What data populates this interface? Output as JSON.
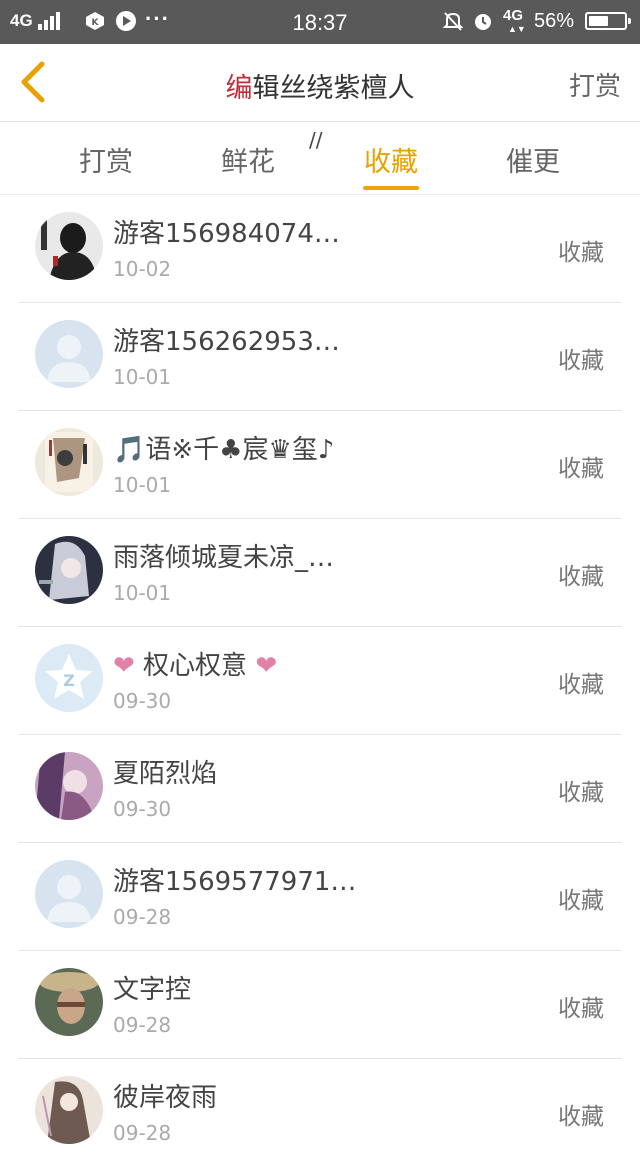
{
  "status_bar": {
    "network": "4G",
    "time": "18:37",
    "network2": "4G",
    "battery": "56%",
    "battery_level": 0.56
  },
  "header": {
    "title_accent": "编",
    "title_rest": "辑丝绕紫檀人",
    "tip_button": "打赏"
  },
  "tabs": [
    {
      "label": "打赏",
      "active": false
    },
    {
      "label": "鲜花",
      "active": false
    },
    {
      "label": "收藏",
      "active": true
    },
    {
      "label": "催更",
      "active": false
    }
  ],
  "tab_mark": "//",
  "colors": {
    "accent": "#e8a200",
    "status_bar": "#595959",
    "heart": "#e37fa8"
  },
  "rows": [
    {
      "name": "游客156984074…",
      "date": "10-02",
      "action": "收藏",
      "avatar": "photo-dark-figure"
    },
    {
      "name": "游客156262953…",
      "date": "10-01",
      "action": "收藏",
      "avatar": "default-user"
    },
    {
      "name": "🎵语※千♣宸♛玺♪",
      "date": "10-01",
      "action": "收藏",
      "avatar": "book-cover"
    },
    {
      "name": "雨落倾城夏未凉_…",
      "date": "10-01",
      "action": "收藏",
      "avatar": "anime-girl"
    },
    {
      "name_prefix": "❤",
      "name": " 权心权意 ",
      "name_suffix": "❤",
      "date": "09-30",
      "action": "收藏",
      "avatar": "star-logo"
    },
    {
      "name": "夏陌烈焰",
      "date": "09-30",
      "action": "收藏",
      "avatar": "anime-purple"
    },
    {
      "name": "游客1569577971…",
      "date": "09-28",
      "action": "收藏",
      "avatar": "default-user"
    },
    {
      "name": "文字控",
      "date": "09-28",
      "action": "收藏",
      "avatar": "photo-man"
    },
    {
      "name": "彼岸夜雨",
      "date": "09-28",
      "action": "收藏",
      "avatar": "anime-sketch"
    }
  ]
}
